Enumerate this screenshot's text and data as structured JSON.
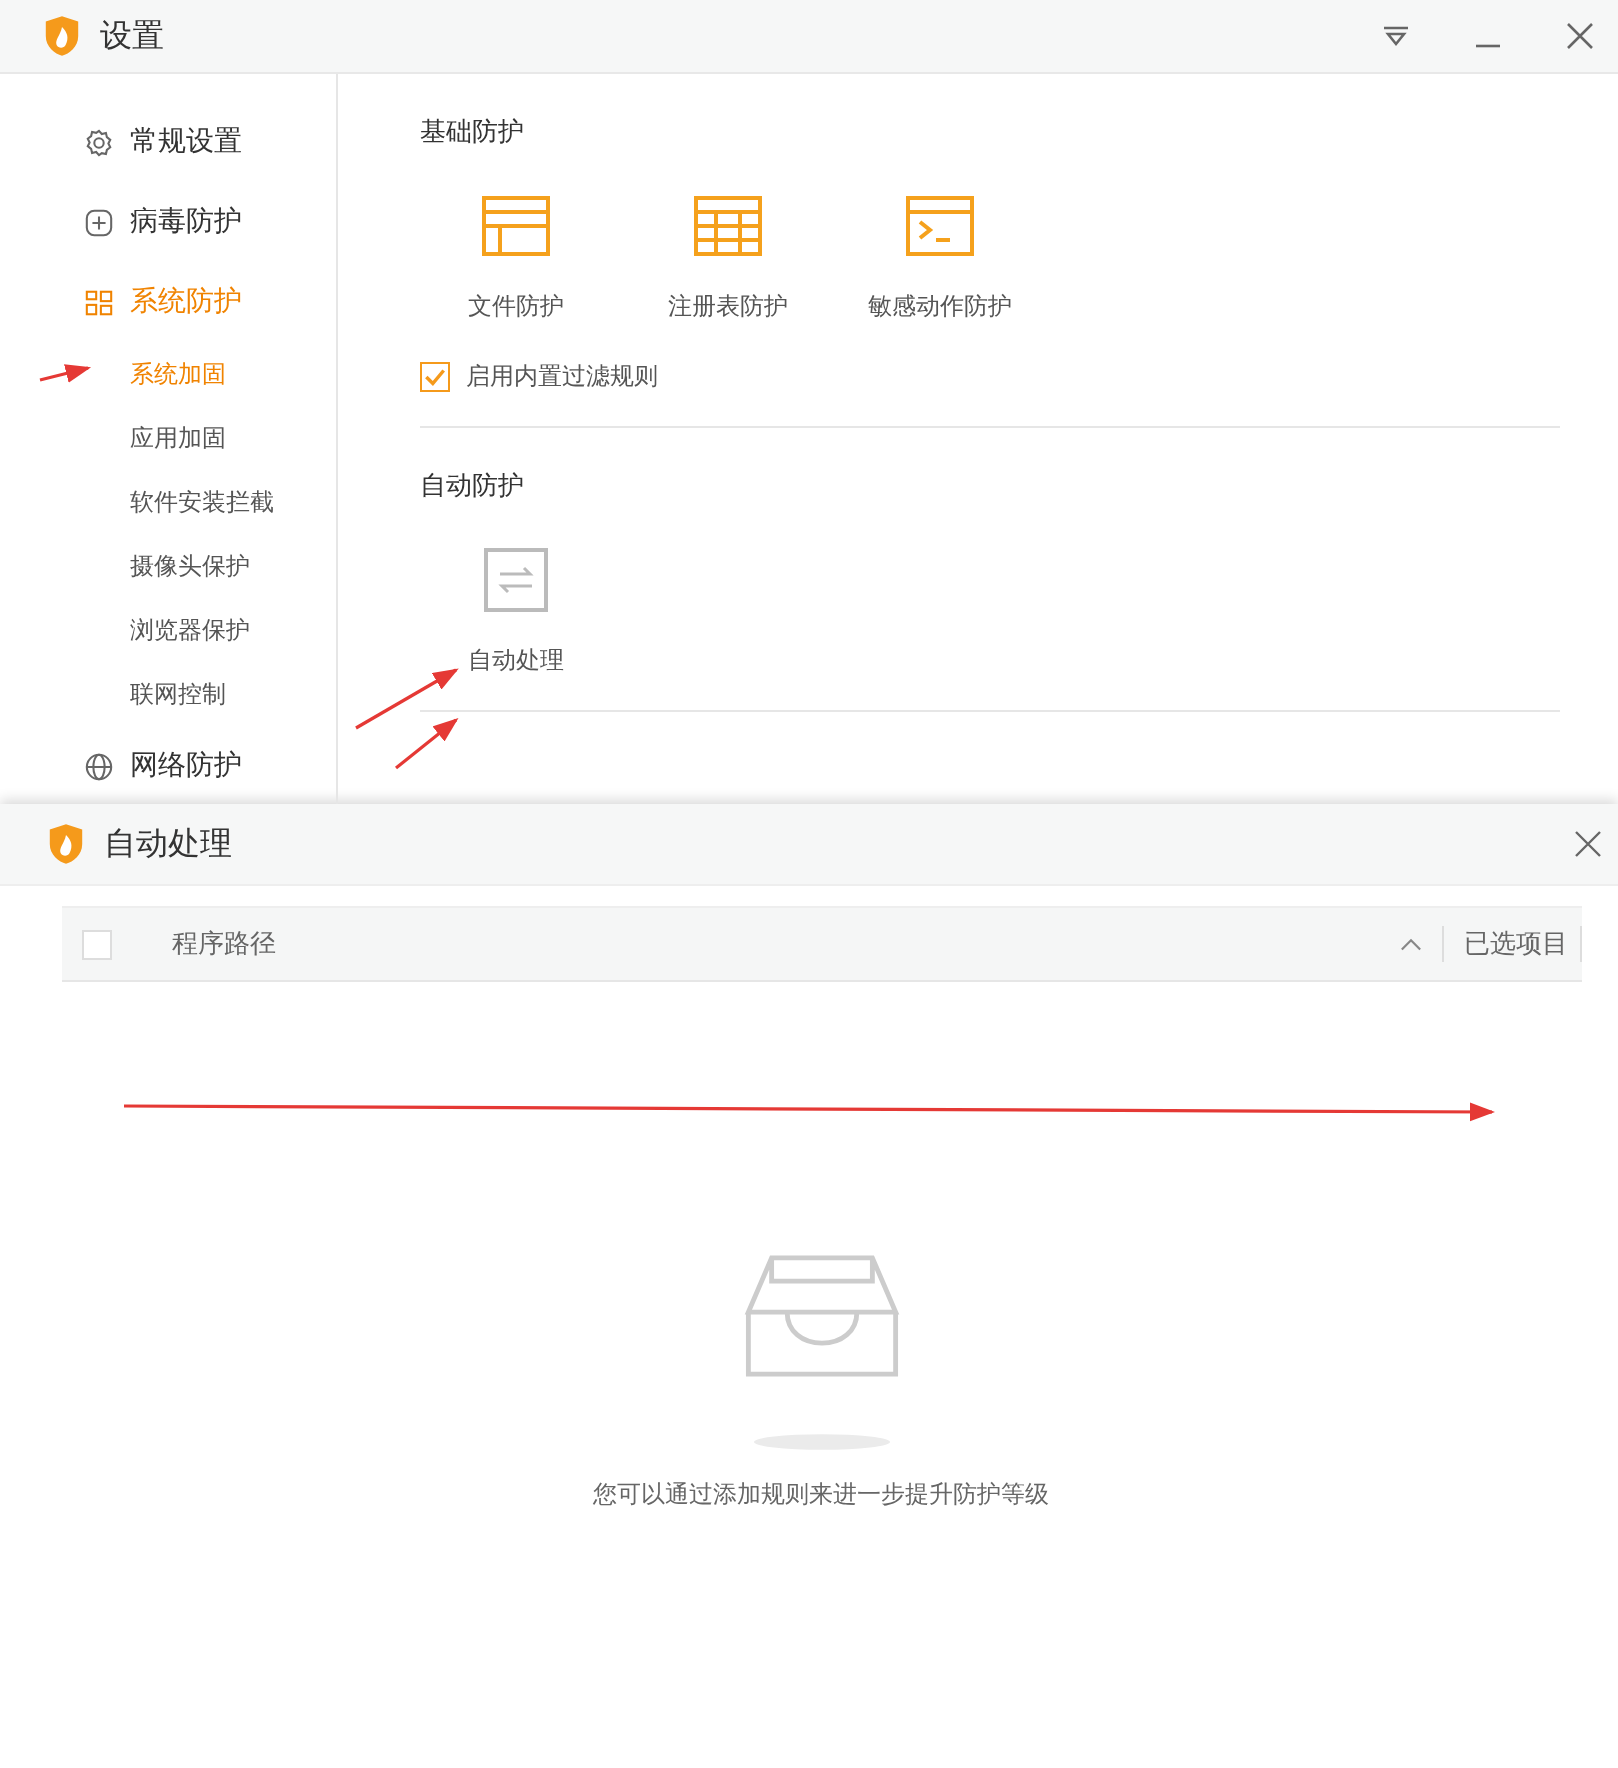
{
  "window": {
    "title": "设置"
  },
  "sidebar": {
    "items": [
      {
        "label": "常规设置",
        "selected": false
      },
      {
        "label": "病毒防护",
        "selected": false
      },
      {
        "label": "系统防护",
        "selected": true,
        "children": [
          {
            "label": "系统加固",
            "selected": true
          },
          {
            "label": "应用加固",
            "selected": false
          },
          {
            "label": "软件安装拦截",
            "selected": false
          },
          {
            "label": "摄像头保护",
            "selected": false
          },
          {
            "label": "浏览器保护",
            "selected": false
          },
          {
            "label": "联网控制",
            "selected": false
          }
        ]
      },
      {
        "label": "网络防护",
        "selected": false
      }
    ]
  },
  "sections": [
    {
      "title": "基础防护",
      "tiles": [
        {
          "label": "文件防护",
          "disabled": false
        },
        {
          "label": "注册表防护",
          "disabled": false
        },
        {
          "label": "敏感动作防护",
          "disabled": false
        }
      ],
      "option": {
        "label": "启用内置过滤规则",
        "checked": true
      }
    },
    {
      "title": "自动防护",
      "tiles": [
        {
          "label": "自动处理",
          "disabled": true
        }
      ]
    }
  ],
  "dialog": {
    "title": "自动处理",
    "table": {
      "columns": [
        "程序路径",
        "已选项目"
      ],
      "all_checked": false
    },
    "empty_text": "您可以通过添加规则来进一步提升防护等级"
  }
}
